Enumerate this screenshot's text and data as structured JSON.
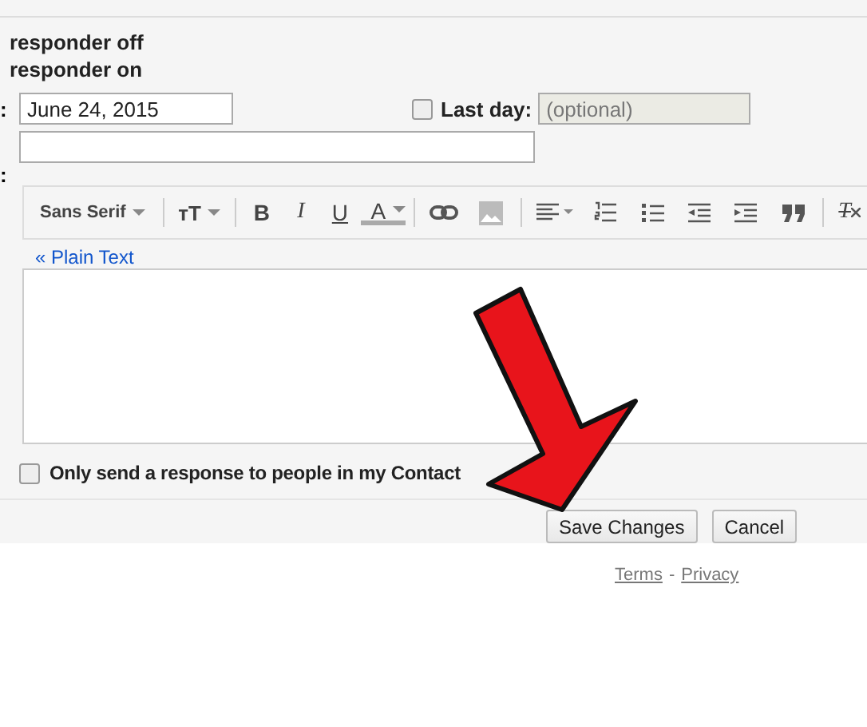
{
  "responder_options": [
    "responder off",
    "responder on"
  ],
  "first_day": {
    "label": ":",
    "value": "June 24, 2015"
  },
  "last_day": {
    "checked": false,
    "label": "Last day:",
    "placeholder": "(optional)",
    "disabled": true
  },
  "message_label": ":",
  "toolbar": [
    {
      "kind": "font",
      "label": "Sans Serif"
    },
    {
      "kind": "separator"
    },
    {
      "kind": "text-size",
      "label": "тT"
    },
    {
      "kind": "separator"
    },
    {
      "kind": "bold",
      "label": "B"
    },
    {
      "kind": "italic",
      "label": "I"
    },
    {
      "kind": "underline",
      "label": "U"
    },
    {
      "kind": "text-color",
      "label": "A"
    },
    {
      "kind": "separator"
    },
    {
      "kind": "link"
    },
    {
      "kind": "image"
    },
    {
      "kind": "separator"
    },
    {
      "kind": "align"
    },
    {
      "kind": "numbered-list"
    },
    {
      "kind": "bulleted-list"
    },
    {
      "kind": "indent-less"
    },
    {
      "kind": "indent-more"
    },
    {
      "kind": "quote"
    },
    {
      "kind": "separator"
    },
    {
      "kind": "clear-format",
      "label": "T"
    }
  ],
  "plain_text_link": "« Plain Text",
  "contacts_only": {
    "checked": false,
    "label": "Only send a response to people in my Contact"
  },
  "buttons": [
    "Save Changes",
    "Cancel"
  ],
  "footer": {
    "links": [
      "Terms",
      "Privacy"
    ],
    "separator": "-"
  }
}
